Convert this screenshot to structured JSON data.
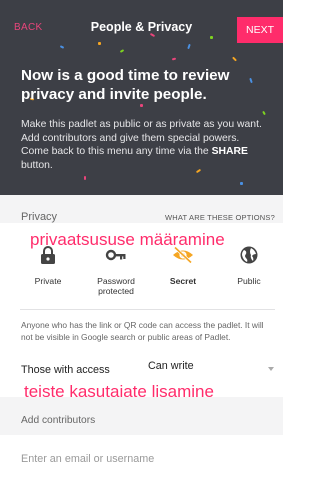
{
  "header": {
    "back_label": "BACK",
    "title": "People & Privacy",
    "next_label": "NEXT",
    "headline": "Now is a good time to review privacy and invite people.",
    "intro_text": "Make this padlet as public or as private as you want. Add contributors and give them special powers. Come back to this menu any time via the ",
    "intro_emphasis": "SHARE",
    "intro_tail": " button."
  },
  "privacy": {
    "label": "Privacy",
    "options_link": "WHAT ARE THESE OPTIONS?",
    "annotation": "privaatsususe määramine",
    "options": [
      {
        "label": "Private",
        "icon": "lock-icon",
        "selected": false
      },
      {
        "label": "Password protected",
        "icon": "key-icon",
        "selected": false
      },
      {
        "label": "Secret",
        "icon": "eye-slash-icon",
        "selected": true
      },
      {
        "label": "Public",
        "icon": "globe-icon",
        "selected": false
      }
    ],
    "description": "Anyone who has the link or QR code can access the padlet. It will not be visible in Google search or public areas of Padlet."
  },
  "access": {
    "label": "Those with access",
    "value": "Can write",
    "annotation": "teiste kasutajate lisamine"
  },
  "contributors": {
    "label": "Add contributors",
    "input_placeholder": "Enter an email or username"
  },
  "colors": {
    "header_bg": "#3d3f46",
    "accent": "#ff2c6b",
    "selected_icon": "#f5a623",
    "icon": "#444444"
  }
}
